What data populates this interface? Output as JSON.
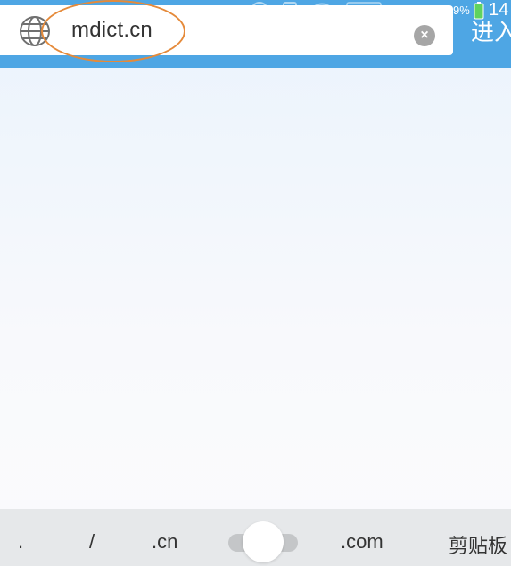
{
  "address_bar": {
    "url_value": "mdict.cn",
    "enter_label": "进入"
  },
  "status_bar": {
    "battery_text": "9%",
    "time_text": "14"
  },
  "suggestions": {
    "items": [
      ".",
      "/",
      ".cn",
      ".com"
    ],
    "clipboard_label": "剪贴板"
  },
  "colors": {
    "accent": "#4ea6e4",
    "annotation": "#e58a3a"
  },
  "icons": {
    "globe": "globe-icon",
    "clear": "clear-icon"
  }
}
